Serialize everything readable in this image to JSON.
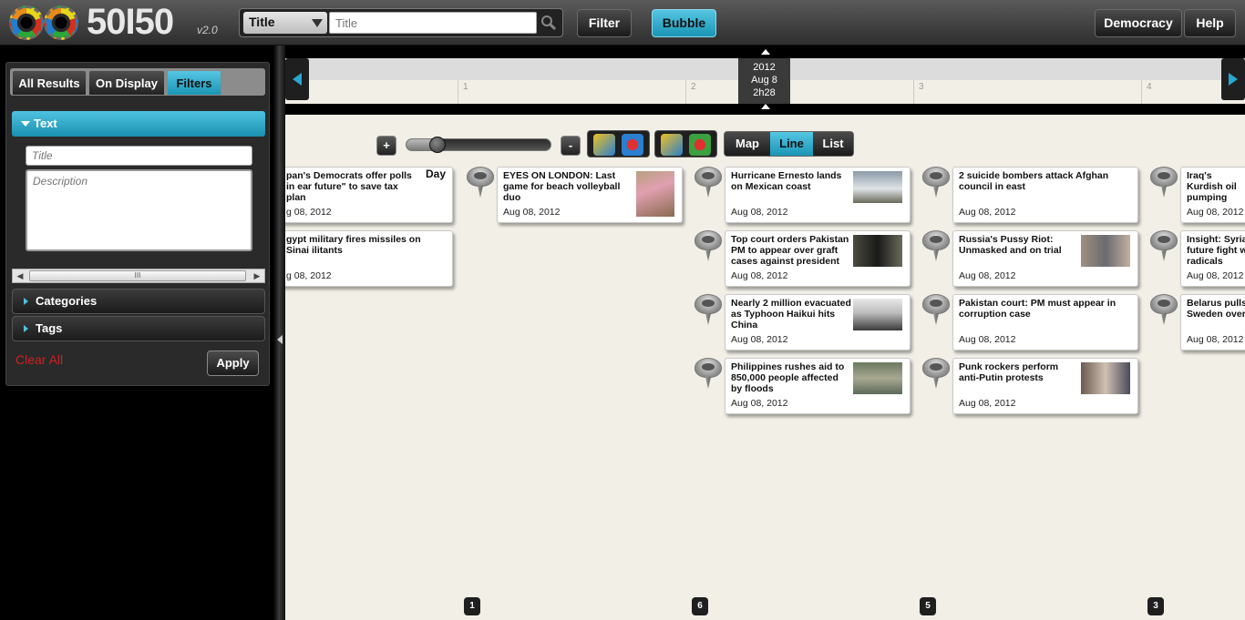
{
  "app": {
    "logo_text": "50I50",
    "version": "v2.0"
  },
  "search": {
    "field_selected": "Title",
    "placeholder": "Title"
  },
  "topbar": {
    "filter_label": "Filter",
    "bubble_label": "Bubble",
    "democracy_label": "Democracy",
    "help_label": "Help"
  },
  "sidebar": {
    "tabs": [
      {
        "label": "All Results"
      },
      {
        "label": "On Display"
      },
      {
        "label": "Filters",
        "active": true
      }
    ],
    "text_section": {
      "label": "Text",
      "title_placeholder": "Title",
      "description_placeholder": "Description"
    },
    "categories_label": "Categories",
    "tags_label": "Tags",
    "clear_all_label": "Clear All",
    "apply_label": "Apply"
  },
  "timeline": {
    "ticks": [
      "1",
      "2",
      "3",
      "4"
    ],
    "marker": {
      "year": "2012",
      "date": "Aug 8",
      "time": "2h28"
    }
  },
  "controls": {
    "zoom_in": "+",
    "zoom_out": "-",
    "zoom_level": 0.2,
    "views": [
      "Map",
      "Line",
      "List"
    ],
    "active_view": "Line",
    "scale_label": "Day"
  },
  "columns": [
    {
      "count": "1",
      "cards": [
        {
          "title": "EYES ON LONDON: Last game for beach volleyball duo",
          "date": "Aug 08, 2012",
          "thumb": "volleyball-photo"
        }
      ]
    },
    {
      "count": "6",
      "cards": [
        {
          "title": "Hurricane Ernesto lands on Mexican coast",
          "date": "Aug 08, 2012",
          "thumb": "palm-beach-photo"
        },
        {
          "title": "Top court orders Pakistan PM to appear over graft cases against president",
          "date": "Aug 08, 2012",
          "thumb": "pm-photo"
        },
        {
          "title": "Nearly 2 million evacuated as Typhoon Haikui hits China",
          "date": "Aug 08, 2012",
          "thumb": "typhoon-photo"
        },
        {
          "title": "Philippines rushes aid to 850,000 people affected by floods",
          "date": "Aug 08, 2012",
          "thumb": "flood-photo"
        }
      ]
    },
    {
      "count": "5",
      "cards": [
        {
          "title": "2 suicide bombers attack Afghan council in east",
          "date": "Aug 08, 2012"
        },
        {
          "title": "Russia's Pussy Riot: Unmasked and on trial",
          "date": "Aug 08, 2012",
          "thumb": "trial-photo"
        },
        {
          "title": "Pakistan court: PM must appear in corruption case",
          "date": "Aug 08, 2012"
        },
        {
          "title": "Punk rockers perform anti-Putin protests",
          "date": "Aug 08, 2012",
          "thumb": "protest-photo"
        }
      ]
    },
    {
      "count": "3",
      "cards": [
        {
          "title": "Iraq's Kurdish oil pumping",
          "date": "Aug 08, 2012"
        },
        {
          "title": "Insight: Syria future fight w radicals",
          "date": "Aug 08, 2012"
        },
        {
          "title": "Belarus pulls Sweden over",
          "date": "Aug 08, 2012"
        }
      ]
    }
  ],
  "left_partial_cards": [
    {
      "title": "pan's Democrats offer polls in ear future\" to save tax plan",
      "date": "g 08, 2012"
    },
    {
      "title": "gypt military fires missiles on Sinai ilitants",
      "date": "g 08, 2012"
    }
  ],
  "colors": {
    "accent": "#1fa3c4",
    "danger": "#d02020",
    "background": "#f1efe6"
  }
}
